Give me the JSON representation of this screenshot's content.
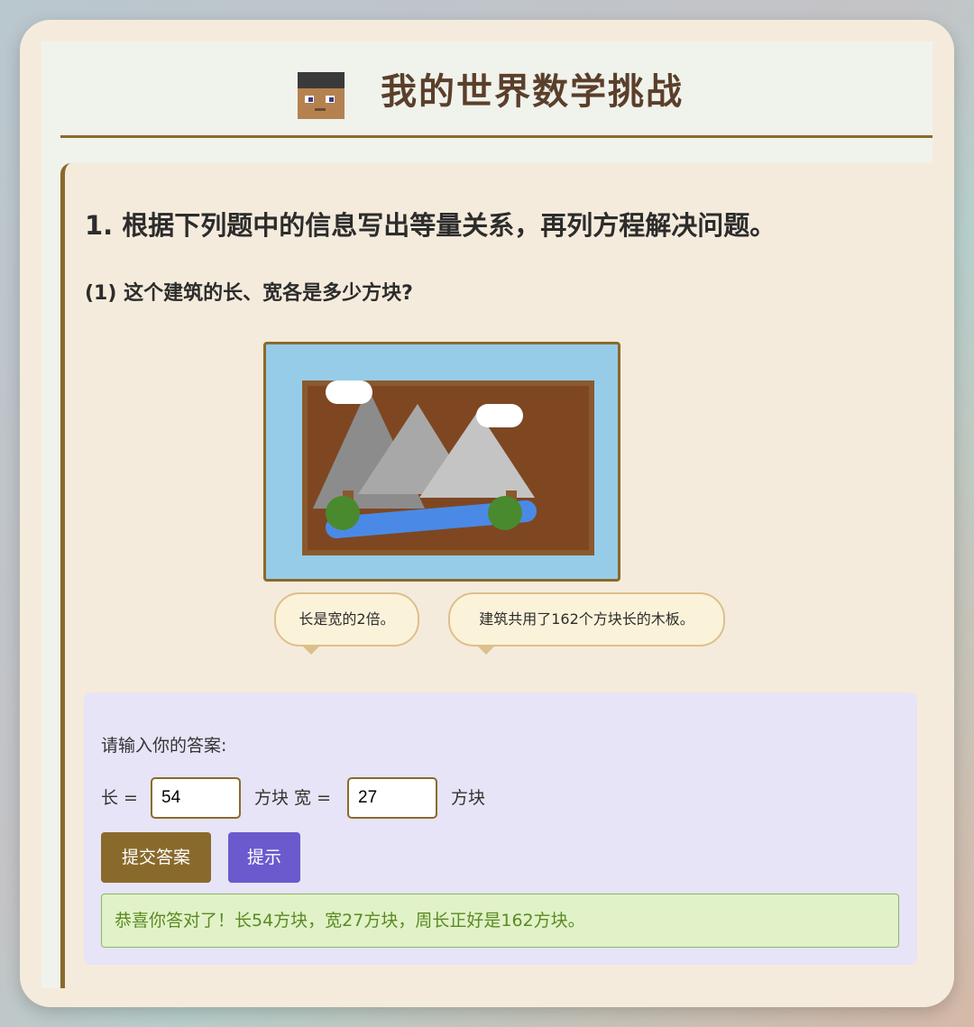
{
  "header": {
    "title": "我的世界数学挑战",
    "avatar_icon": "steve-face-icon"
  },
  "question": {
    "title": "1. 根据下列题中的信息写出等量关系，再列方程解决问题。",
    "subtitle": "(1) 这个建筑的长、宽各是多少方块?",
    "bubbles": [
      "长是宽的2倍。",
      "建筑共用了162个方块长的木板。"
    ]
  },
  "answer": {
    "prompt": "请输入你的答案:",
    "length_label": "长 =",
    "length_value": "54",
    "unit_label": "方块",
    "width_label": "方块 宽 =",
    "width_value": "27",
    "submit_label": "提交答案",
    "hint_label": "提示",
    "result_text": "恭喜你答对了！长54方块，宽27方块，周长正好是162方块。"
  },
  "colors": {
    "accent": "#8a6a2c",
    "hint": "#6a5acd",
    "success_bg": "#e1f2c8",
    "success_text": "#5a8a22"
  }
}
